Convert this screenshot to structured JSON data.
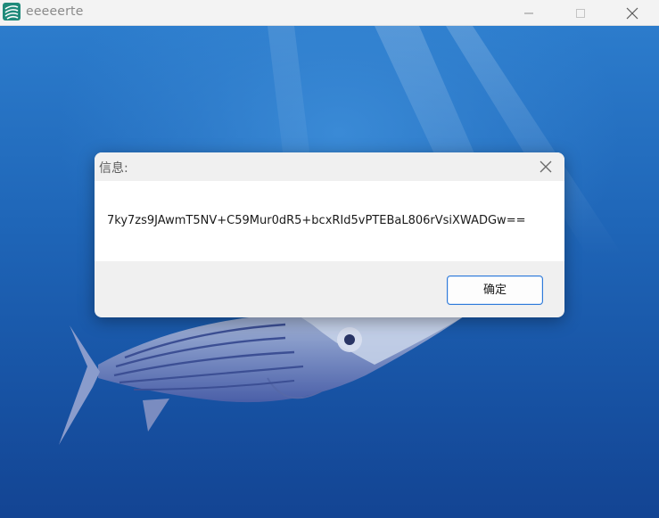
{
  "window": {
    "title": "eeeeerte",
    "app_icon": "app-logo-icon",
    "controls": [
      "minimize-icon",
      "maximize-icon",
      "close-icon"
    ]
  },
  "background": {
    "description_icon": "fish-wallpaper"
  },
  "dialog": {
    "title": "信息:",
    "message": "7ky7zs9JAwmT5NV+C59Mur0dR5+bcxRId5vPTEBaL806rVsiXWADGw==",
    "ok_label": "确定"
  },
  "colors": {
    "titlebar": "#f3f3f3",
    "dialog_background": "#f0f0f0",
    "dialog_body": "#ffffff",
    "button_border": "#2f7ad9",
    "wallpaper_blue": "#1d5fb0"
  }
}
